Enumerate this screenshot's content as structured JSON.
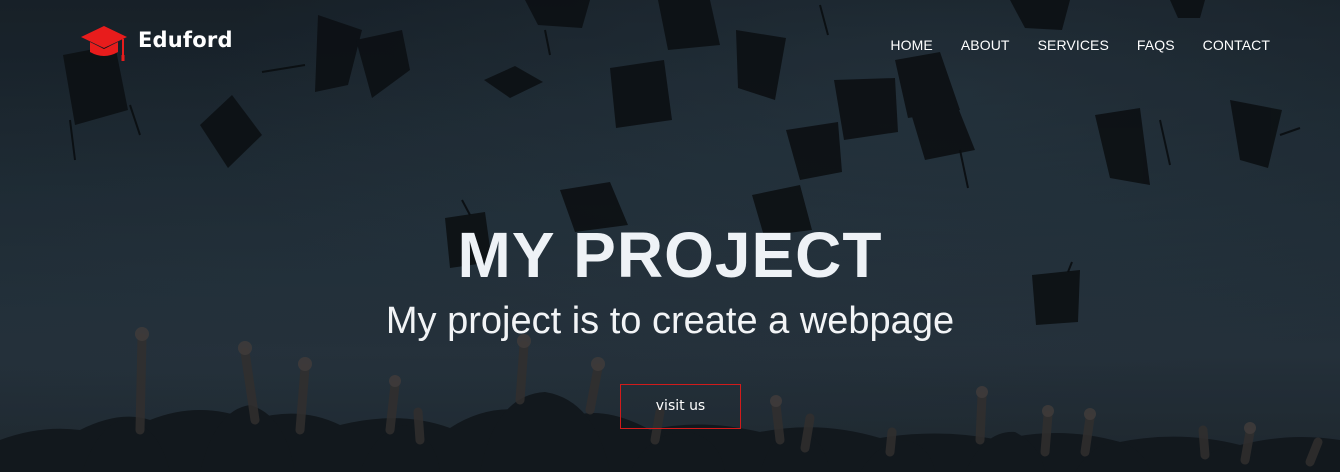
{
  "brand": {
    "name": "Eduford",
    "logo_icon": "graduation-cap-icon",
    "logo_color": "#e81c1c"
  },
  "nav": {
    "items": [
      {
        "label": "HOME"
      },
      {
        "label": "ABOUT"
      },
      {
        "label": "SERVICES"
      },
      {
        "label": "FAQS"
      },
      {
        "label": "CONTACT"
      }
    ]
  },
  "hero": {
    "title": "MY PROJECT",
    "subtitle": "My project is to create a webpage",
    "cta_label": "visit us",
    "cta_border_color": "#d11b1b",
    "background_description_icon": "graduation-caps-thrown-photo"
  }
}
